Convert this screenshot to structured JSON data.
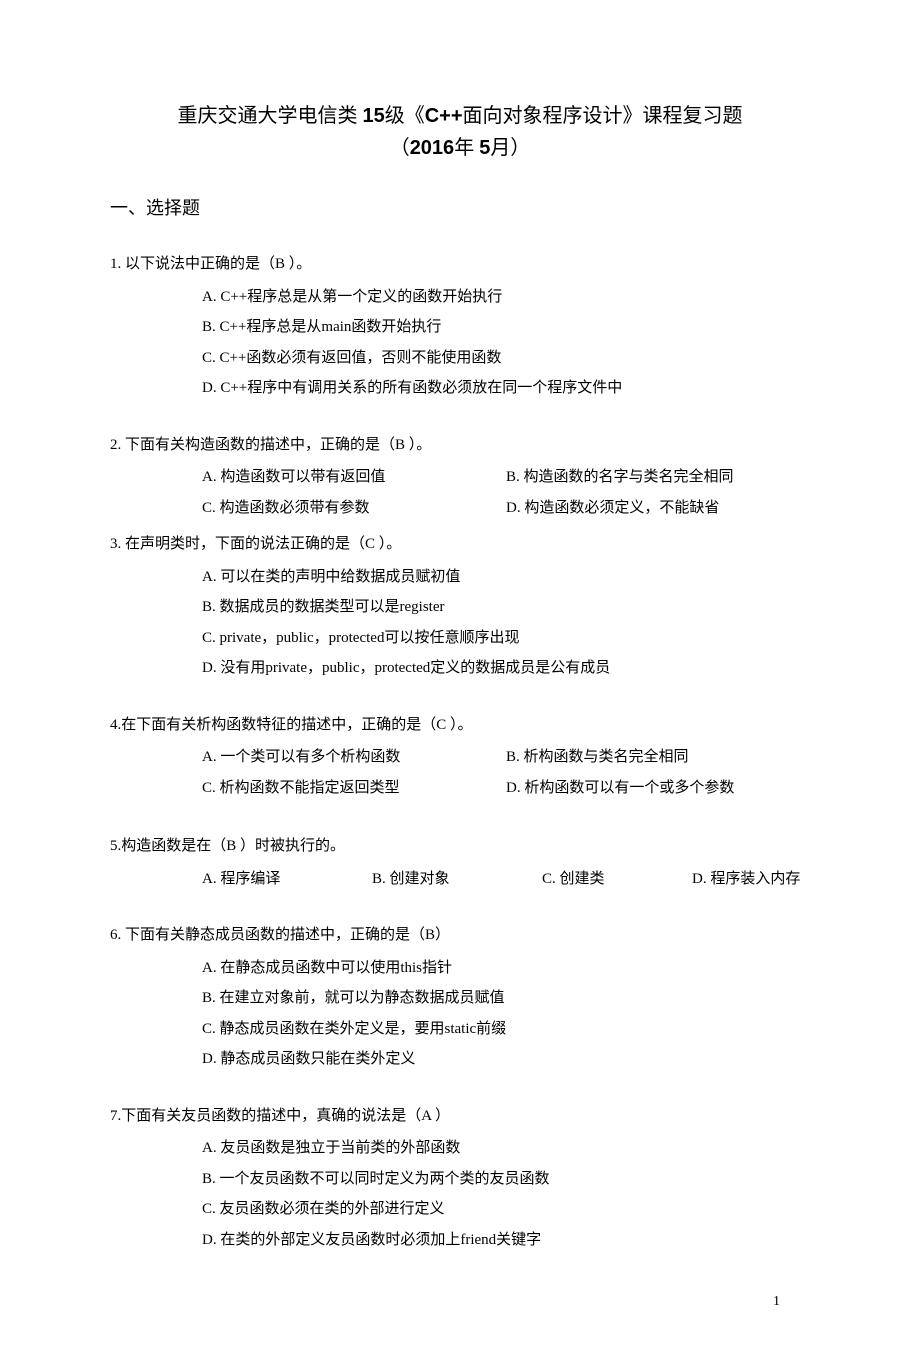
{
  "title": {
    "line1_pre": "重庆交通大学电信类 ",
    "line1_bold": "15",
    "line1_mid": "级《",
    "line1_bold2": "C++",
    "line1_post": "面向对象程序设计》课程复习题",
    "line2_pre": "（",
    "line2_bold": "2016",
    "line2_mid": "年   ",
    "line2_bold2": "5",
    "line2_post": "月）"
  },
  "section_heading": "一、选择题",
  "questions": [
    {
      "stem": "1.  以下说法中正确的是（B    ）。",
      "layout": "single",
      "options": [
        "A.  C++程序总是从第一个定义的函数开始执行",
        "B.  C++程序总是从main函数开始执行",
        "C.  C++函数必须有返回值，否则不能使用函数",
        "D.  C++程序中有调用关系的所有函数必须放在同一个程序文件中"
      ]
    },
    {
      "stem": "2.  下面有关构造函数的描述中，正确的是（B    ）。",
      "layout": "two-col",
      "left": [
        "A.  构造函数可以带有返回值",
        "C.  构造函数必须带有参数"
      ],
      "right": [
        "B.  构造函数的名字与类名完全相同",
        "D.  构造函数必须定义，不能缺省"
      ]
    },
    {
      "stem": "3.  在声明类时，下面的说法正确的是（C    ）。",
      "layout": "single",
      "options": [
        "A.  可以在类的声明中给数据成员赋初值",
        "B.  数据成员的数据类型可以是register",
        "C.  private，public，protected可以按任意顺序出现",
        "D.  没有用private，public，protected定义的数据成员是公有成员"
      ]
    },
    {
      "stem": "4.在下面有关析构函数特征的描述中，正确的是（C    ）。",
      "layout": "two-col",
      "left": [
        "A.  一个类可以有多个析构函数",
        "C.  析构函数不能指定返回类型"
      ],
      "right": [
        "B.  析构函数与类名完全相同",
        "D.  析构函数可以有一个或多个参数"
      ]
    },
    {
      "stem": "5.构造函数是在（B    ）时被执行的。",
      "layout": "four-col",
      "options": [
        "A.  程序编译",
        "B.  创建对象",
        "C.  创建类",
        "D.  程序装入内存"
      ]
    },
    {
      "stem": "6.  下面有关静态成员函数的描述中，正确的是（B）",
      "layout": "single",
      "options": [
        "A.  在静态成员函数中可以使用this指针",
        "B.  在建立对象前，就可以为静态数据成员赋值",
        "C.  静态成员函数在类外定义是，要用static前缀",
        "D.  静态成员函数只能在类外定义"
      ]
    },
    {
      "stem": "7.下面有关友员函数的描述中，真确的说法是（A  ）",
      "layout": "single",
      "options": [
        "A.  友员函数是独立于当前类的外部函数",
        "B.  一个友员函数不可以同时定义为两个类的友员函数",
        "C.  友员函数必须在类的外部进行定义",
        "D.  在类的外部定义友员函数时必须加上friend关键字"
      ]
    }
  ],
  "page_number": "1"
}
